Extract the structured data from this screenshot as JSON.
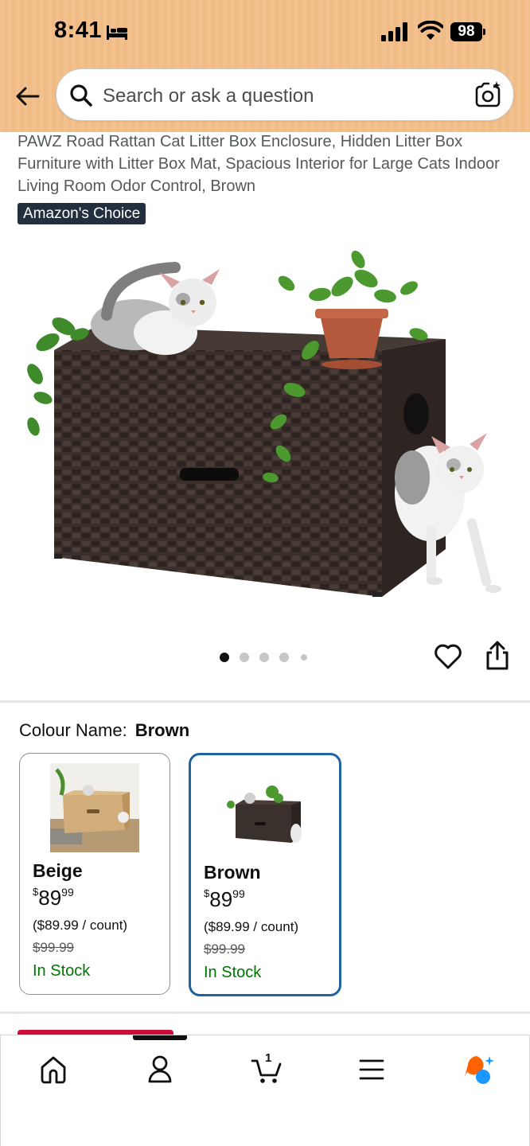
{
  "status_bar": {
    "time": "8:41",
    "battery": "98"
  },
  "search": {
    "placeholder": "Search or ask a question"
  },
  "product": {
    "title": "PAWZ Road Rattan Cat Litter Box Enclosure, Hidden Litter Box Furniture with Litter Box Mat, Spacious Interior for Large Cats Indoor Living Room Odor Control, Brown",
    "badge": "Amazon's Choice",
    "image_count": 5,
    "active_image": 1
  },
  "colour": {
    "label": "Colour Name:",
    "selected": "Brown"
  },
  "swatches": [
    {
      "name": "Beige",
      "currency": "$",
      "price_whole": "89",
      "price_cents": "99",
      "unit_price": "($89.99 / count)",
      "list_price": "$99.99",
      "availability": "In Stock",
      "selected": false
    },
    {
      "name": "Brown",
      "currency": "$",
      "price_whole": "89",
      "price_cents": "99",
      "unit_price": "($89.99 / count)",
      "list_price": "$99.99",
      "availability": "In Stock",
      "selected": true
    }
  ],
  "bottom_nav": {
    "items": [
      "home-icon",
      "account-icon",
      "cart-icon",
      "menu-icon",
      "rufus-icon"
    ],
    "cart_count": "1"
  },
  "colors": {
    "accent": "#2162a1",
    "in_stock": "#007600",
    "header": "#f3c18e",
    "badge": "#232f3e",
    "rufus_orange": "#ff6200",
    "rufus_blue": "#1a98ff"
  }
}
